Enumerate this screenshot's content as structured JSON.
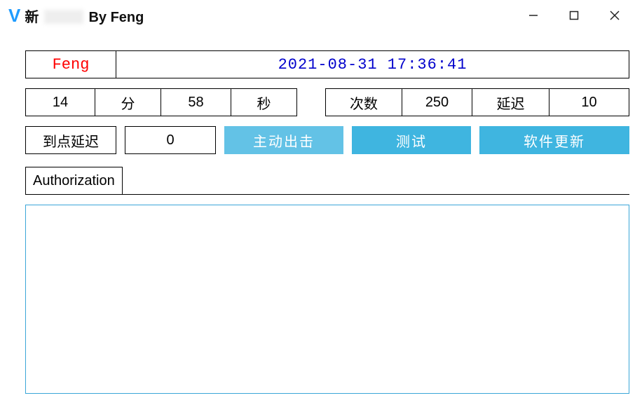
{
  "titlebar": {
    "logo": "V",
    "title_prefix": "新",
    "title_suffix": "By Feng"
  },
  "header": {
    "author": "Feng",
    "datetime": "2021-08-31 17:36:41"
  },
  "timer": {
    "minute_value": "14",
    "minute_label": "分",
    "second_value": "58",
    "second_label": "秒",
    "count_label": "次数",
    "count_value": "250",
    "delay_label": "延迟",
    "delay_value": "10"
  },
  "controls": {
    "arrive_delay_label": "到点延迟",
    "arrive_delay_value": "0",
    "attack_btn": "主动出击",
    "test_btn": "测试",
    "update_btn": "软件更新"
  },
  "tabs": {
    "auth": "Authorization"
  },
  "colors": {
    "accent": "#3fb5e0",
    "accent_light": "#63c2e6",
    "author_text": "#f00",
    "datetime_text": "#0000cc"
  }
}
